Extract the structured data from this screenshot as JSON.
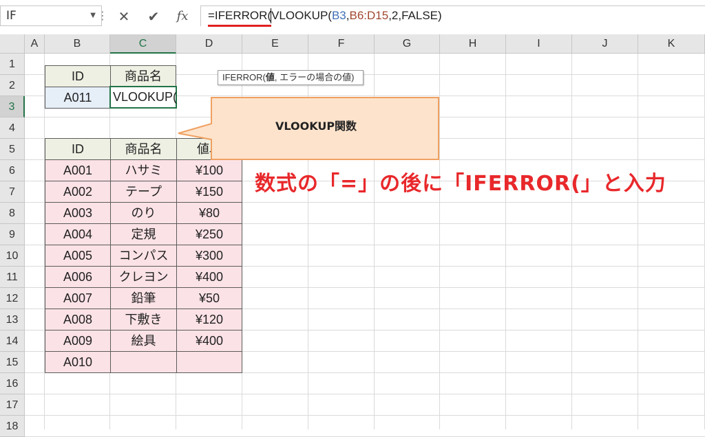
{
  "formula_bar": {
    "name_box": "IF",
    "cancel_glyph": "✕",
    "enter_glyph": "✔",
    "fx_label": "fx",
    "formula_parts": {
      "p1": "=IFERROR(",
      "p2": "VLOOKUP(",
      "p3": "B3",
      "p4": ",",
      "p5": "B6:D15",
      "p6": ",2,FALSE)"
    }
  },
  "tooltip": {
    "func": "IFERROR(",
    "arg": "値",
    "rest": ", エラーの場合の値)"
  },
  "columns": [
    "A",
    "B",
    "C",
    "D",
    "E",
    "F",
    "G",
    "H",
    "I",
    "J",
    "K"
  ],
  "selected_column": "C",
  "rows": [
    "1",
    "2",
    "3",
    "4",
    "5",
    "6",
    "7",
    "8",
    "9",
    "10",
    "11",
    "12",
    "13",
    "14",
    "15",
    "16",
    "17",
    "18"
  ],
  "selected_row": "3",
  "lookup_table": {
    "headers": [
      "ID",
      "商品名"
    ],
    "id_value": "A011",
    "active_cell_value": "VLOOKUP("
  },
  "product_table": {
    "headers": [
      "ID",
      "商品名",
      "値段"
    ],
    "rows": [
      [
        "A001",
        "ハサミ",
        "¥100"
      ],
      [
        "A002",
        "テープ",
        "¥150"
      ],
      [
        "A003",
        "のり",
        "¥80"
      ],
      [
        "A004",
        "定規",
        "¥250"
      ],
      [
        "A005",
        "コンパス",
        "¥300"
      ],
      [
        "A006",
        "クレヨン",
        "¥400"
      ],
      [
        "A007",
        "鉛筆",
        "¥50"
      ],
      [
        "A008",
        "下敷き",
        "¥120"
      ],
      [
        "A009",
        "絵具",
        "¥400"
      ],
      [
        "A010",
        "",
        ""
      ]
    ]
  },
  "callout": {
    "text": "VLOOKUP関数",
    "fill": "#fde3cc",
    "stroke": "#f0a060"
  },
  "note": {
    "text": "数式の「=」の後に「IFERROR(」と入力",
    "color": "#e8282b"
  },
  "colors": {
    "accent": "#217346",
    "header_fill": "#eef0e3",
    "data_fill": "#fbe2e6",
    "lookup_fill": "#e6eef8"
  }
}
